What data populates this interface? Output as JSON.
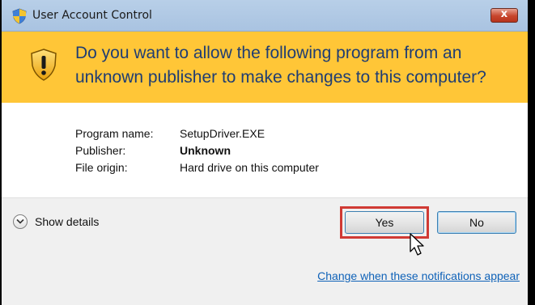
{
  "window": {
    "title": "User Account Control",
    "close_label": "x"
  },
  "banner": {
    "question": "Do you want to allow the following program from an unknown publisher to make changes to this computer?"
  },
  "details": {
    "rows": [
      {
        "label": "Program name:",
        "value": "SetupDriver.EXE"
      },
      {
        "label": "Publisher:",
        "value": "Unknown"
      },
      {
        "label": "File origin:",
        "value": "Hard drive on this computer"
      }
    ]
  },
  "footer": {
    "show_details": "Show details",
    "yes_label": "Yes",
    "no_label": "No",
    "notify_link": "Change when these notifications appear"
  },
  "colors": {
    "banner": "#ffc637",
    "question_text": "#1f3d73",
    "link": "#0f62b8",
    "highlight": "#d03a34"
  },
  "icons": {
    "title": "uac-shield-icon",
    "banner": "warning-shield-icon",
    "details": "chevron-down-icon",
    "cursor": "mouse-pointer-icon"
  }
}
